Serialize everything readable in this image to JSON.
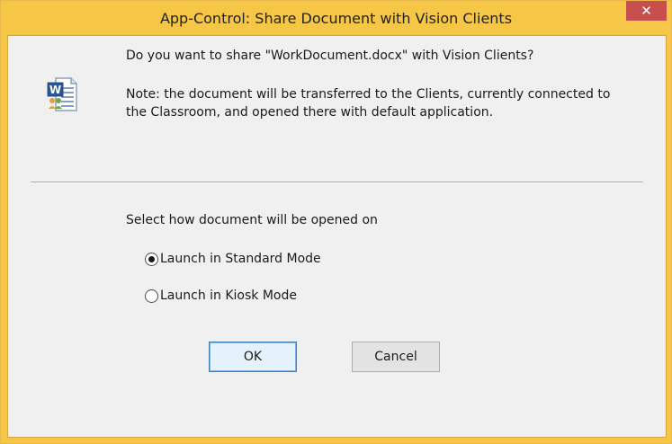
{
  "dialog": {
    "title": "App-Control: Share Document with Vision Clients",
    "close_glyph": "✕",
    "icon": "word-document-icon",
    "question": "Do you want to share \"WorkDocument.docx\" with Vision Clients?",
    "note": "Note: the document will be transferred to the Clients, currently connected to the Classroom, and opened there with default application.",
    "select_label": "Select how document will be opened on",
    "options": [
      {
        "label": "Launch in Standard Mode",
        "selected": true
      },
      {
        "label": "Launch in Kiosk Mode",
        "selected": false
      }
    ],
    "ok_label": "OK",
    "cancel_label": "Cancel"
  },
  "colors": {
    "titlebar": "#f6c746",
    "close_button": "#c7504f",
    "client_background": "#f0f0f0"
  }
}
